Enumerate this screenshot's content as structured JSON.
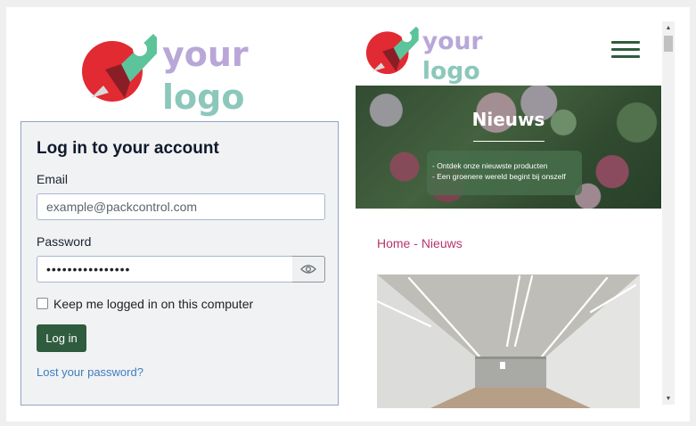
{
  "login": {
    "logo": {
      "line1": "your",
      "line2": "logo"
    },
    "title": "Log in to your account",
    "email_label": "Email",
    "email_placeholder": "example@packcontrol.com",
    "password_label": "Password",
    "password_value": "••••••••••••••••",
    "show_password_icon": "eye-icon",
    "remember_label": "Keep me logged in on this computer",
    "remember_checked": false,
    "login_button": "Log in",
    "lost_password_link": "Lost your password?"
  },
  "site": {
    "logo": {
      "line1": "your",
      "line2": "logo"
    },
    "menu_icon": "hamburger-menu-icon",
    "hero": {
      "title": "Nieuws",
      "lines": [
        "- Ontdek onze nieuwste producten",
        "- Een groenere wereld begint bij onszelf"
      ]
    },
    "breadcrumb": {
      "home": "Home",
      "separator": " - ",
      "current": "Nieuws"
    },
    "photo": "warehouse-corridor-photo"
  },
  "colors": {
    "accent_green": "#2f5c3e",
    "breadcrumb_pink": "#b8336a",
    "link_blue": "#3d7dbf",
    "card_border": "#8fa4c4",
    "logo_purple": "#b9a7d8",
    "logo_teal": "#8cc7bc",
    "rocket_red": "#e22a33",
    "rocket_green": "#5cc49a"
  }
}
